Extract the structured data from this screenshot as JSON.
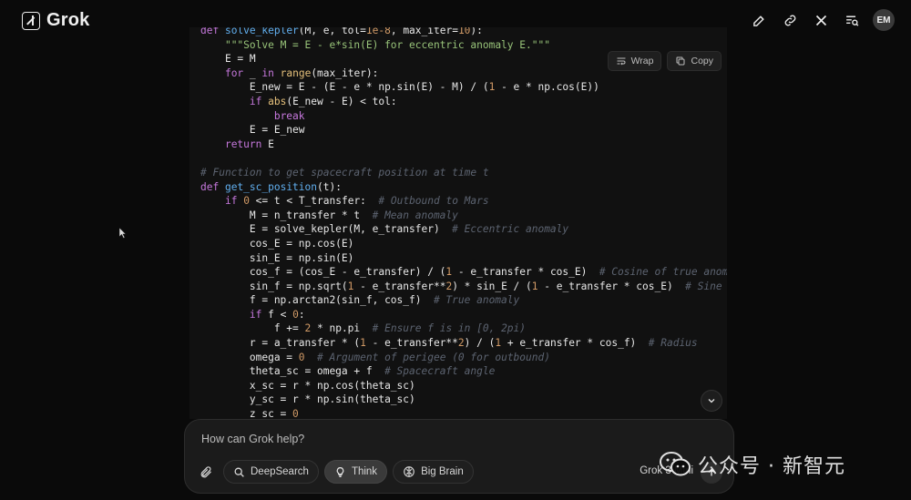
{
  "app": {
    "name": "Grok"
  },
  "header": {
    "icons": [
      "edit-icon",
      "link-icon",
      "x-logo-icon",
      "search-history-icon"
    ],
    "avatar_initials": "EM"
  },
  "code_block": {
    "wrap_label": "Wrap",
    "copy_label": "Copy",
    "lines": [
      "def solve_kepler(M, e, tol=1e-8, max_iter=10):",
      "    \"\"\"Solve M = E - e*sin(E) for eccentric anomaly E.\"\"\"",
      "    E = M",
      "    for _ in range(max_iter):",
      "        E_new = E - (E - e * np.sin(E) - M) / (1 - e * np.cos(E))",
      "        if abs(E_new - E) < tol:",
      "            break",
      "        E = E_new",
      "    return E",
      "",
      "# Function to get spacecraft position at time t",
      "def get_sc_position(t):",
      "    if 0 <= t < T_transfer:  # Outbound to Mars",
      "        M = n_transfer * t  # Mean anomaly",
      "        E = solve_kepler(M, e_transfer)  # Eccentric anomaly",
      "        cos_E = np.cos(E)",
      "        sin_E = np.sin(E)",
      "        cos_f = (cos_E - e_transfer) / (1 - e_transfer * cos_E)  # Cosine of true anomal",
      "        sin_f = np.sqrt(1 - e_transfer**2) * sin_E / (1 - e_transfer * cos_E)  # Sine of",
      "        f = np.arctan2(sin_f, cos_f)  # True anomaly",
      "        if f < 0:",
      "            f += 2 * np.pi  # Ensure f is in [0, 2pi)",
      "        r = a_transfer * (1 - e_transfer**2) / (1 + e_transfer * cos_f)  # Radius",
      "        omega = 0  # Argument of perigee (0 for outbound)",
      "        theta_sc = omega + f  # Spacecraft angle",
      "        x_sc = r * np.cos(theta_sc)",
      "        y_sc = r * np.sin(theta_sc)",
      "        z_sc = 0"
    ]
  },
  "composer": {
    "placeholder": "How can Grok help?",
    "buttons": {
      "deepsearch": "DeepSearch",
      "think": "Think",
      "bigbrain": "Big Brain"
    },
    "model": "Grok 3 Mini"
  },
  "watermark": {
    "text": "公众号 · 新智元"
  },
  "colors": {
    "background": "#0a0a0a",
    "code_bg": "#111111",
    "keyword": "#c678dd",
    "function": "#61afef",
    "number": "#d19a66",
    "string": "#98c379",
    "comment": "#5c6370"
  }
}
